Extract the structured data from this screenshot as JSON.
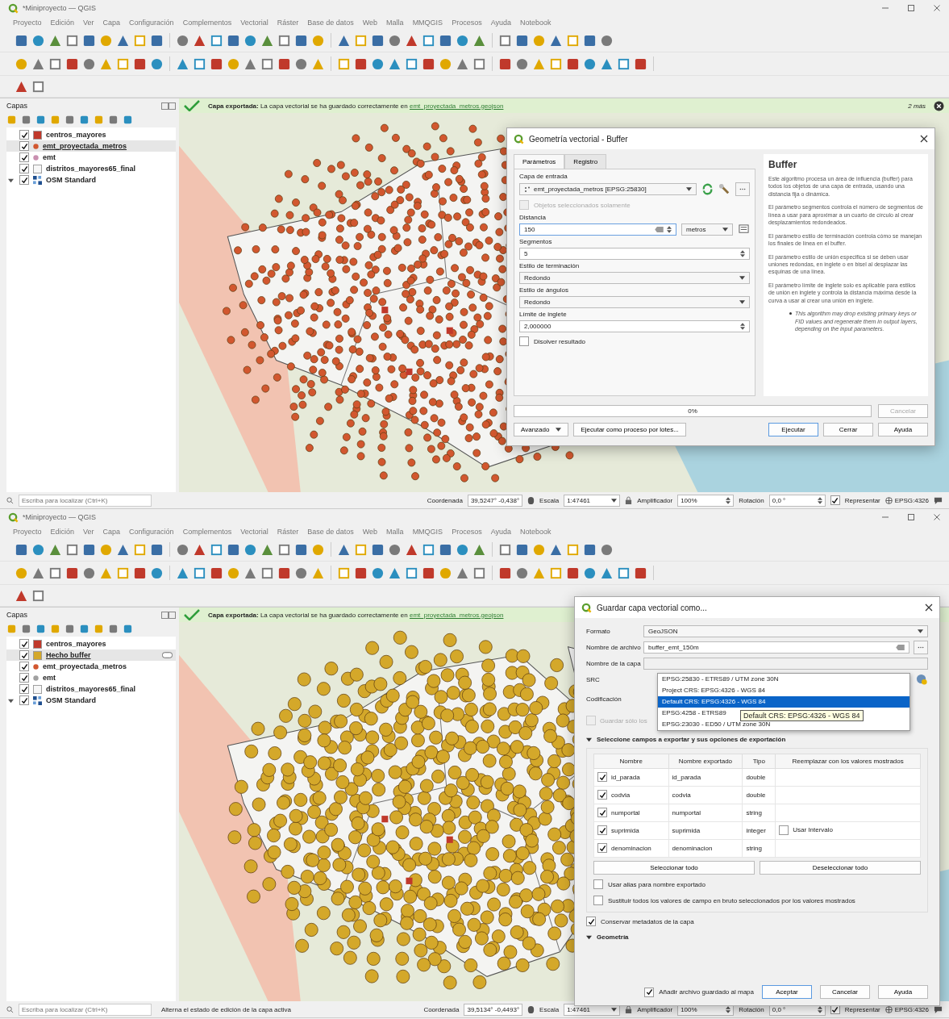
{
  "windows": [
    {
      "title": "*Miniproyecto — QGIS",
      "menu": [
        "Proyecto",
        "Edición",
        "Ver",
        "Capa",
        "Configuración",
        "Complementos",
        "Vectorial",
        "Ráster",
        "Base de datos",
        "Web",
        "Malla",
        "MMQGIS",
        "Procesos",
        "Ayuda",
        "Notebook"
      ],
      "panel_title": "Capas",
      "layers": [
        {
          "name": "centros_mayores",
          "kind": "polygon",
          "color": "#c0392b",
          "checked": true,
          "selected": false,
          "indicator": false
        },
        {
          "name": "emt_proyectada_metros",
          "kind": "point",
          "color": "#d2572f",
          "checked": true,
          "selected": true,
          "indicator": false
        },
        {
          "name": "emt",
          "kind": "point",
          "color": "#c98fb0",
          "checked": true,
          "selected": false,
          "indicator": false
        },
        {
          "name": "distritos_mayores65_final",
          "kind": "polygon",
          "color": "#f7f7f7",
          "checked": true,
          "selected": false,
          "indicator": false
        },
        {
          "name": "OSM Standard",
          "kind": "raster",
          "color": "#1f4f8f",
          "checked": true,
          "selected": false,
          "indicator": false,
          "expanded": true
        }
      ],
      "message": {
        "text": "**Capa exportada:** La capa vectorial se ha guardado correctamente en",
        "link": "emt_proyectada_metros.geojson",
        "more": "2 más"
      },
      "status": {
        "search_placeholder": "Escriba para localizar (Ctrl+K)",
        "coordinate_label": "Coordenada",
        "coordinate": "39,5247° -0,438°",
        "scale_label": "Escala",
        "scale": "1:47461",
        "magnifier_label": "Amplificador",
        "magnifier": "100%",
        "rotation_label": "Rotación",
        "rotation": "0,0 °",
        "render_label": "Representar",
        "render": true,
        "crs": "EPSG:4326"
      },
      "dialog": {
        "kind": "buffer",
        "title": "Geometría vectorial - Buffer",
        "tabs": [
          {
            "label": "Parámetros",
            "selected": true
          },
          {
            "label": "Registro",
            "selected": false
          }
        ],
        "fields": [
          {
            "kind": "layer",
            "label": "Capa de entrada",
            "value": "emt_proyectada_metros [EPSG:25830]"
          },
          {
            "kind": "checkbox",
            "label": "Objetos seleccionados solamente",
            "checked": false,
            "disabled": true
          },
          {
            "kind": "distance",
            "label": "Distancia",
            "value": "150",
            "unit": "metros"
          },
          {
            "kind": "spin",
            "label": "Segmentos",
            "value": "5"
          },
          {
            "kind": "combo",
            "label": "Estilo de terminación",
            "value": "Redondo"
          },
          {
            "kind": "combo",
            "label": "Estilo de ángulos",
            "value": "Redondo"
          },
          {
            "kind": "spin",
            "label": "Límite de inglete",
            "value": "2,000000"
          },
          {
            "kind": "checkbox",
            "label": "Disolver resultado",
            "checked": false,
            "disabled": false
          }
        ],
        "help": {
          "title": "Buffer",
          "paragraphs": [
            "Este algoritmo procesa un área de influencia (buffer) para todos los objetos de una capa de entrada, usando una distancia fija o dinámica.",
            "El parámetro segmentos controla el número de segmentos de línea a usar para aproximar a un cuarto de círculo al crear desplazamientos redondeados.",
            "El parámetro estilo de terminación controla cómo se manejan los finales de línea en el buffer.",
            "El parámetro estilo de unión especifica si se deben usar uniones redondas, en inglete o en bisel al desplazar las esquinas de una línea.",
            "El parámetro límite de inglete solo es aplicable para estilos de unión en inglete y controla la distancia máxima desde la curva a usar al crear una unión en inglete."
          ],
          "note": "This algorithm may drop existing primary keys or FID values and regenerate them in output layers, depending on the input parameters."
        },
        "progress": {
          "level": 0,
          "text": "0%"
        },
        "cancel": {
          "label": "Cancelar",
          "disabled": true
        },
        "left_buttons": [
          {
            "label": "Avanzado",
            "kind": "menu"
          },
          {
            "label": "Ejecutar como proceso por lotes...",
            "kind": "plain"
          }
        ],
        "buttons": [
          {
            "label": "Ejecutar",
            "default": true
          },
          {
            "label": "Cerrar",
            "default": false
          },
          {
            "label": "Ayuda",
            "default": false
          }
        ]
      }
    },
    {
      "title": "*Miniproyecto — QGIS",
      "menu": [
        "Proyecto",
        "Edición",
        "Ver",
        "Capa",
        "Configuración",
        "Complementos",
        "Vectorial",
        "Ráster",
        "Base de datos",
        "Web",
        "Malla",
        "MMQGIS",
        "Procesos",
        "Ayuda",
        "Notebook"
      ],
      "panel_title": "Capas",
      "layers": [
        {
          "name": "centros_mayores",
          "kind": "polygon",
          "color": "#c0392b",
          "checked": true,
          "selected": false,
          "indicator": false
        },
        {
          "name": "Hecho buffer",
          "kind": "polygon",
          "color": "#d4a82a",
          "checked": true,
          "selected": true,
          "indicator": true
        },
        {
          "name": "emt_proyectada_metros",
          "kind": "point",
          "color": "#d2572f",
          "checked": true,
          "selected": false,
          "indicator": false
        },
        {
          "name": "emt",
          "kind": "point",
          "color": "#a0a0a0",
          "checked": true,
          "selected": false,
          "indicator": false
        },
        {
          "name": "distritos_mayores65_final",
          "kind": "polygon",
          "color": "#f7f7f7",
          "checked": true,
          "selected": false,
          "indicator": false
        },
        {
          "name": "OSM Standard",
          "kind": "raster",
          "color": "#1f4f8f",
          "checked": true,
          "selected": false,
          "indicator": false,
          "expanded": true
        }
      ],
      "message": {
        "text": "**Capa exportada:** La capa vectorial se ha guardado correctamente en",
        "link": "emt_proyectada_metros.geojson"
      },
      "status": {
        "search_placeholder": "Escriba para localizar (Ctrl+K)",
        "message": "Alterna el estado de edición de la capa activa",
        "coordinate_label": "Coordenada",
        "coordinate": "39,5134° -0,4493°",
        "scale_label": "Escala",
        "scale": "1:47461",
        "magnifier_label": "Amplificador",
        "magnifier": "100%",
        "rotation_label": "Rotación",
        "rotation": "0,0 °",
        "render_label": "Representar",
        "render": true,
        "crs": "EPSG:4326"
      },
      "dialog": {
        "kind": "save",
        "title": "Guardar capa vectorial como...",
        "rows": [
          {
            "kind": "combo",
            "label": "Formato",
            "value": "GeoJSON"
          },
          {
            "kind": "file",
            "label": "Nombre de archivo",
            "value": "buffer_emt_150m"
          },
          {
            "kind": "text",
            "label": "Nombre de la capa"
          }
        ],
        "crs_label": "SRC",
        "crs_options": [
          {
            "label": "EPSG:25830 - ETRS89 / UTM zone 30N",
            "selected": false
          },
          {
            "label": "Project CRS: EPSG:4326 - WGS 84",
            "selected": false
          },
          {
            "label": "Default CRS: EPSG:4326 - WGS 84",
            "selected": true
          },
          {
            "label": "EPSG:4258 - ETRS89",
            "selected": false
          },
          {
            "label": "EPSG:23030 - ED50 / UTM zone 30N",
            "selected": false
          }
        ],
        "tooltip": "Default CRS: EPSG:4326 - WGS 84",
        "encoding_label": "Codificación",
        "save_only": {
          "label": "Guardar sólo los",
          "checked": false,
          "disabled": true
        },
        "fields_section": {
          "title": "Seleccione campos a exportar y sus opciones de exportación",
          "expanded": true,
          "columns": [
            "Nombre",
            "Nombre exportado",
            "Tipo",
            "Reemplazar con los valores mostrados"
          ],
          "rows": [
            {
              "checked": true,
              "name": "id_parada",
              "exported": "id_parada",
              "type": "double"
            },
            {
              "checked": true,
              "name": "codvia",
              "exported": "codvia",
              "type": "double"
            },
            {
              "checked": true,
              "name": "numportal",
              "exported": "numportal",
              "type": "string"
            },
            {
              "checked": true,
              "name": "suprimida",
              "exported": "suprimida",
              "type": "integer",
              "interval": {
                "label": "Usar Intervalo",
                "checked": false
              }
            },
            {
              "checked": true,
              "name": "denominacion",
              "exported": "denominacion",
              "type": "string"
            }
          ],
          "buttons": [
            "Seleccionar todo",
            "Deseleccionar todo"
          ],
          "options": [
            {
              "label": "Usar alias para nombre exportado",
              "checked": false
            },
            {
              "label": "Sustituir todos los valores de campo en bruto seleccionados por los valores mostrados",
              "checked": false
            }
          ]
        },
        "metadata": {
          "label": "Conservar metadatos de la capa",
          "checked": true
        },
        "geometry_section": {
          "title": "Geometría",
          "expanded": true
        },
        "add_to_map": {
          "label": "Añadir archivo guardado al mapa",
          "checked": true
        },
        "buttons": [
          {
            "label": "Aceptar",
            "default": true
          },
          {
            "label": "Cancelar",
            "default": false
          },
          {
            "label": "Ayuda",
            "default": false
          }
        ]
      }
    }
  ]
}
